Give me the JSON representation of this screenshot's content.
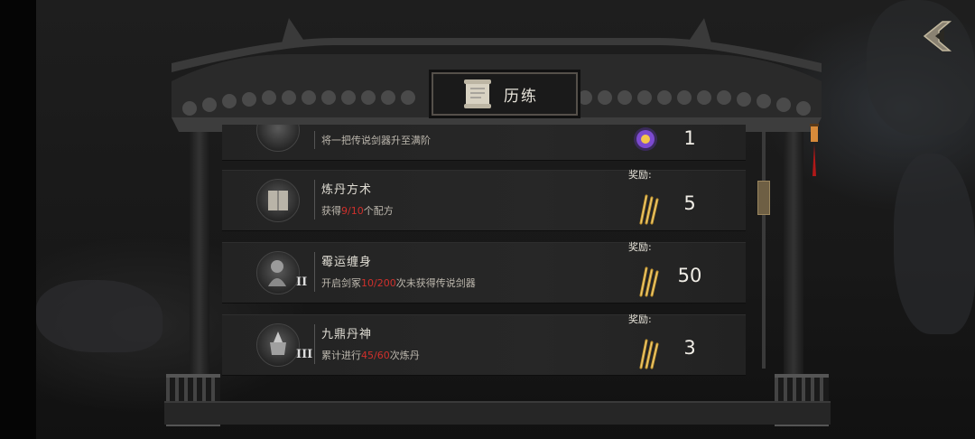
{
  "panel": {
    "title": "历练"
  },
  "achievements": [
    {
      "name": "",
      "desc_parts": [
        "将一把传说剑器升至满阶",
        "",
        "",
        "",
        ""
      ],
      "reward_label": "",
      "reward_icon": "purple-orb-icon",
      "reward_value": "1"
    },
    {
      "name": "炼丹方术",
      "desc_parts": [
        "获得",
        "9",
        "/",
        "10",
        "个配方"
      ],
      "reward_label": "奖励:",
      "reward_icon": "golden-swords-icon",
      "reward_value": "5"
    },
    {
      "name": "霉运缠身",
      "desc_parts": [
        "开启剑冢",
        "10",
        "/",
        "200",
        "次未获得传说剑器"
      ],
      "reward_label": "奖励:",
      "reward_icon": "golden-swords-icon",
      "reward_value": "50",
      "badge": "II"
    },
    {
      "name": "九鼎丹神",
      "desc_parts": [
        "累计进行",
        "45",
        "/",
        "60",
        "次炼丹"
      ],
      "reward_label": "奖励:",
      "reward_icon": "golden-swords-icon",
      "reward_value": "3",
      "badge": "III"
    }
  ],
  "colors": {
    "highlight": "#d0302c",
    "background": "#151515",
    "row": "#252525"
  }
}
